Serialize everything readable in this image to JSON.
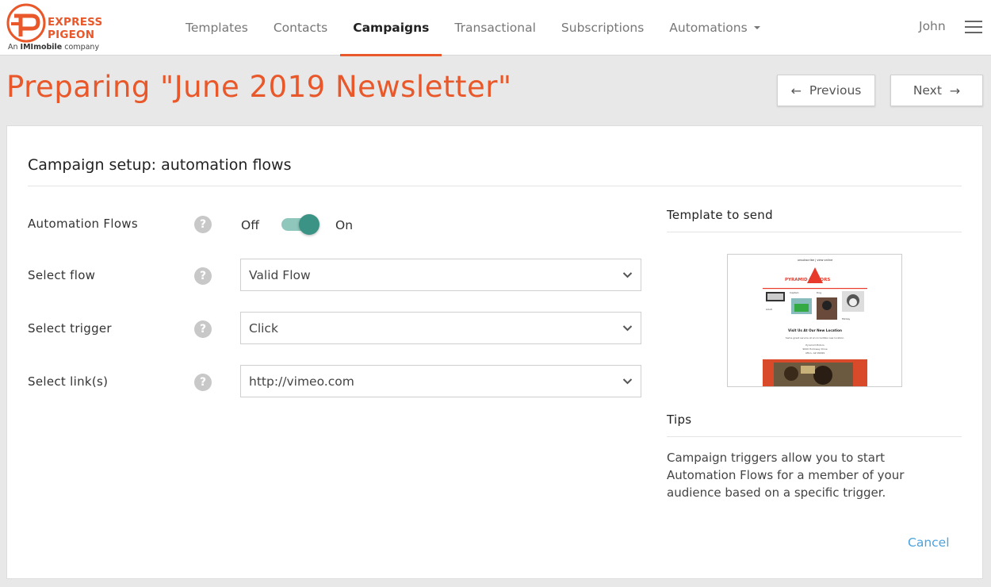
{
  "brand": {
    "line1": "EXPRESS",
    "line2": "PIGEON",
    "tagline_prefix": "An ",
    "tagline_brand": "IMImobile",
    "tagline_suffix": " company",
    "color": "#e8582a"
  },
  "nav": {
    "items": [
      {
        "label": "Templates",
        "active": false
      },
      {
        "label": "Contacts",
        "active": false
      },
      {
        "label": "Campaigns",
        "active": true
      },
      {
        "label": "Transactional",
        "active": false
      },
      {
        "label": "Subscriptions",
        "active": false
      },
      {
        "label": "Automations",
        "active": false,
        "dropdown": true
      }
    ],
    "user": "John"
  },
  "header": {
    "title": "Preparing \"June 2019 Newsletter\"",
    "previous_label": "Previous",
    "next_label": "Next"
  },
  "card": {
    "title": "Campaign setup: automation flows",
    "automation_flows": {
      "label": "Automation Flows",
      "off_label": "Off",
      "on_label": "On",
      "enabled": true
    },
    "select_flow": {
      "label": "Select flow",
      "value": "Valid Flow"
    },
    "select_trigger": {
      "label": "Select trigger",
      "value": "Click"
    },
    "select_links": {
      "label": "Select link(s)",
      "value": "http://vimeo.com"
    },
    "help_glyph": "?",
    "template_title": "Template to send",
    "thumbnail": {
      "top_links": "unsubscribe | view online",
      "logo": "PYRAMID MOTORS",
      "name_a": "Captain",
      "name_b": "Dog",
      "name_c": "Adult",
      "name_d": "Mickey",
      "headline": "Visit Us At Our New Location",
      "body": "Same great service at an incredible new location.",
      "addr1": "Pyramid Motors",
      "addr2": "9000 Holloway Drive",
      "addr3": "Afton, AZ 99999"
    },
    "tips_title": "Tips",
    "tips_text": "Campaign triggers allow you to start Automation Flows for a member of your audience based on a specific trigger.",
    "cancel_label": "Cancel"
  },
  "colors": {
    "accent": "#e8582a",
    "toggle": "#3a9384",
    "link": "#4aa3df"
  }
}
